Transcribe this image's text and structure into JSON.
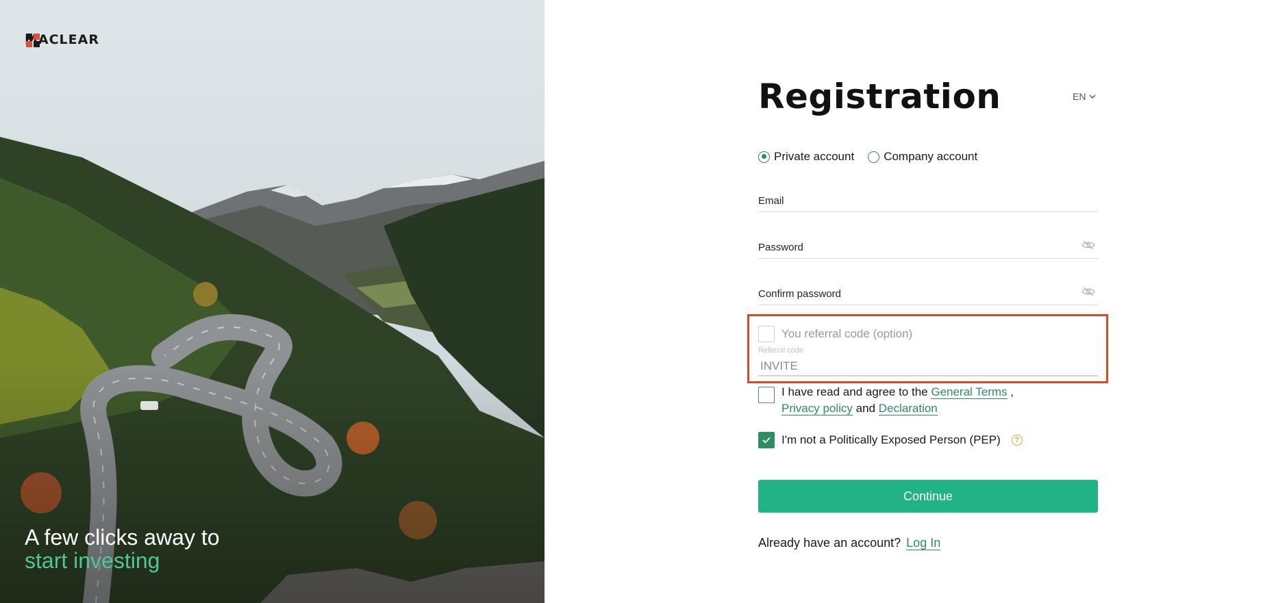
{
  "brand": {
    "name": "MACLEAR"
  },
  "hero": {
    "tagline_line1": "A few clicks away to",
    "tagline_line2": "start investing",
    "accent_color": "#4fc69a"
  },
  "form": {
    "title": "Registration",
    "language": "EN",
    "account_types": [
      {
        "label": "Private account",
        "selected": true
      },
      {
        "label": "Company account",
        "selected": false
      }
    ],
    "fields": {
      "email_label": "Email",
      "password_label": "Password",
      "confirm_password_label": "Confirm password"
    },
    "referral": {
      "checkbox_label": "You referral code (option)",
      "checked": false,
      "small_label": "Referral code",
      "value": "INVITE"
    },
    "terms": {
      "checked": false,
      "text_before": "I have read and agree to the",
      "general_terms": "General Terms",
      "comma": ",",
      "privacy_policy": "Privacy policy",
      "and": "and",
      "declaration": "Declaration"
    },
    "pep": {
      "checked": true,
      "label": "I'm not a Politically Exposed Person (PEP)",
      "info_glyph": "?"
    },
    "continue_label": "Continue",
    "login": {
      "prompt": "Already have an account?",
      "link": "Log In"
    },
    "colors": {
      "primary": "#21b386",
      "link": "#2c8a6a",
      "highlight_border": "#e2461f"
    }
  }
}
